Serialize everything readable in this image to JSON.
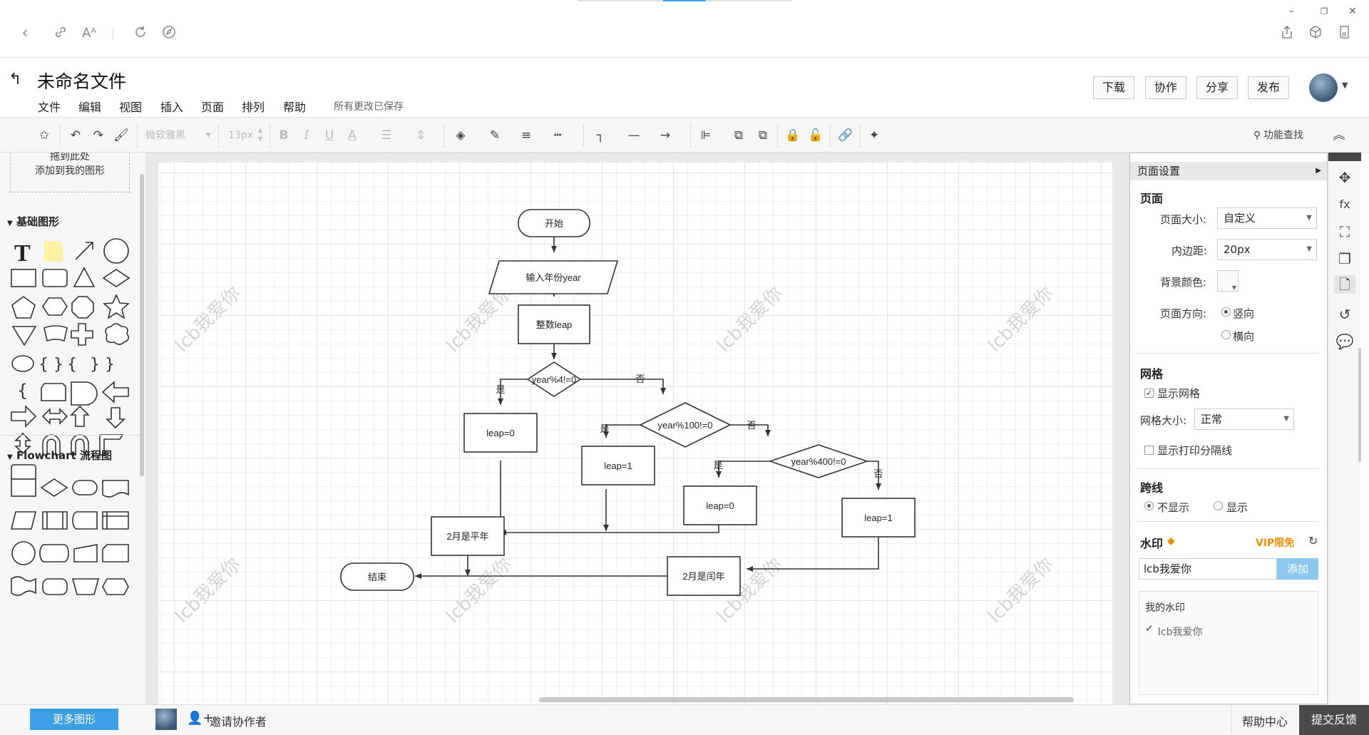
{
  "browser": {
    "icons": [
      "back-icon",
      "link-icon",
      "font-size-icon",
      "refresh-icon",
      "compass-icon"
    ],
    "right_icons": [
      "share-icon",
      "box-icon",
      "device-icon"
    ]
  },
  "header": {
    "title": "未命名文件",
    "menu": [
      "文件",
      "编辑",
      "视图",
      "插入",
      "页面",
      "排列",
      "帮助"
    ],
    "save_status": "所有更改已保存",
    "buttons": {
      "download": "下载",
      "collaborate": "协作",
      "share": "分享",
      "publish": "发布"
    }
  },
  "toolbar": {
    "font_family": "微软雅黑",
    "font_size": "13px",
    "bold": "B",
    "italic": "I",
    "underline": "U",
    "font_color": "A",
    "search_label": "功能查找"
  },
  "left_panel": {
    "drop_hint_line1": "拖到此处",
    "drop_hint_line2": "添加到我的图形",
    "section_basic": "基础图形",
    "section_flowchart": "Flowchart 流程图",
    "more_shapes": "更多图形"
  },
  "diagram": {
    "start": "开始",
    "input": "输入年份year",
    "int_leap": "整数leap",
    "cond1": "year%4!=0",
    "cond2": "year%100!=0",
    "cond3": "year%400!=0",
    "yes": "是",
    "no": "否",
    "leap0_a": "leap=0",
    "leap1_a": "leap=1",
    "leap0_b": "leap=0",
    "leap1_b": "leap=1",
    "not_leap": "2月是平年",
    "is_leap": "2月是闰年",
    "end": "结束"
  },
  "watermark_text": "lcb我爱你",
  "right_panel": {
    "title": "页面设置",
    "page_section": "页面",
    "page_size_label": "页面大小:",
    "page_size_value": "自定义",
    "padding_label": "内边距:",
    "padding_value": "20px",
    "bg_color_label": "背景颜色:",
    "orientation_label": "页面方向:",
    "portrait": "竖向",
    "landscape": "横向",
    "grid_section": "网格",
    "show_grid": "显示网格",
    "grid_size_label": "网格大小:",
    "grid_size_value": "正常",
    "show_print_lines": "显示打印分隔线",
    "crossline_section": "跨线",
    "hide": "不显示",
    "show": "显示",
    "watermark_section": "水印",
    "vip_label": "VIP限免",
    "watermark_input": "lcb我爱你",
    "add_button": "添加",
    "my_watermark_label": "我的水印",
    "my_watermark_item": "lcb我爱你"
  },
  "bottom": {
    "invite": "邀请协作者",
    "help_center": "帮助中心",
    "feedback": "提交反馈"
  },
  "colors": {
    "accent_blue": "#3ca0e6",
    "vip_orange": "#f08c00",
    "add_button": "#8cc8f0",
    "feedback_bg": "#4a4a4a"
  }
}
